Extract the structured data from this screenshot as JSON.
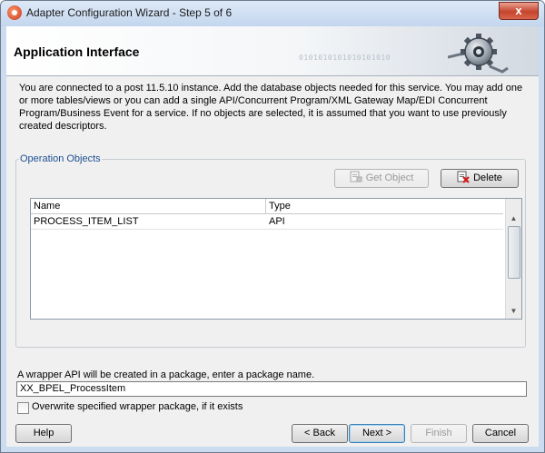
{
  "window": {
    "title": "Adapter Configuration Wizard - Step 5 of 6",
    "close_label": "x"
  },
  "header": {
    "title": "Application Interface",
    "binary_text": "0101010101010101010"
  },
  "intro_text": "You are connected to a post 11.5.10 instance. Add the database objects needed for this service. You may add one or more tables/views or you can add a single API/Concurrent Program/XML Gateway Map/EDI Concurrent Program/Business Event for a service. If no objects are selected, it is assumed that you want to use previously created descriptors.",
  "operation_objects": {
    "legend": "Operation Objects",
    "get_object_label": "Get Object",
    "delete_label": "Delete",
    "columns": [
      "Name",
      "Type"
    ],
    "rows": [
      {
        "name": "PROCESS_ITEM_LIST",
        "type": "API"
      }
    ]
  },
  "package": {
    "label": "A wrapper API will be created in a package, enter a package name.",
    "value": "XX_BPEL_ProcessItem",
    "overwrite_label": "Overwrite specified wrapper package, if it exists",
    "overwrite_checked": false
  },
  "footer": {
    "help_label": "Help",
    "back_label": "< Back",
    "next_label": "Next >",
    "finish_label": "Finish",
    "cancel_label": "Cancel"
  },
  "icons": {
    "window_icon": "oracle-jdeveloper-icon",
    "header_icon": "gear-plug-icon",
    "get_object_icon": "get-object-icon",
    "delete_icon": "delete-icon"
  }
}
